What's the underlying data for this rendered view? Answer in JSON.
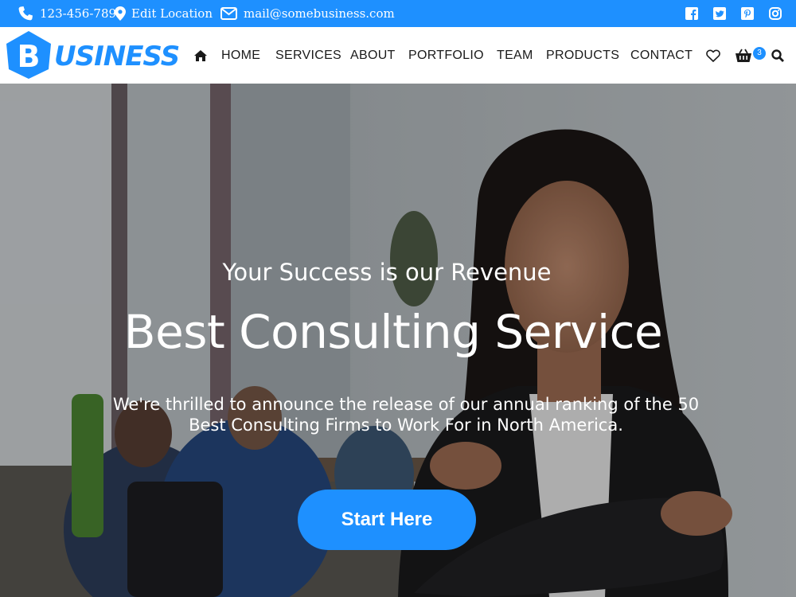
{
  "topbar": {
    "phone": "123-456-789",
    "location": "Edit Location",
    "email": "mail@somebusiness.com",
    "social_icons": [
      "facebook-icon",
      "twitter-icon",
      "pinterest-icon",
      "instagram-icon"
    ]
  },
  "brand": {
    "logo_letter": "B",
    "logo_text": "USINESS",
    "accent_color": "#1e90ff"
  },
  "nav": {
    "items": [
      {
        "label": "HOME"
      },
      {
        "label": "SERVICES"
      },
      {
        "label": "ABOUT"
      },
      {
        "label": "PORTFOLIO"
      },
      {
        "label": "TEAM"
      },
      {
        "label": "PRODUCTS"
      },
      {
        "label": "CONTACT"
      }
    ],
    "cart_count": "3"
  },
  "hero": {
    "kicker": "Your Success is our Revenue",
    "title": "Best Consulting Service",
    "description": "We're thrilled to announce the release of our annual ranking of the 50 Best Consulting Firms to Work For in North America.",
    "button_label": "Start Here"
  }
}
